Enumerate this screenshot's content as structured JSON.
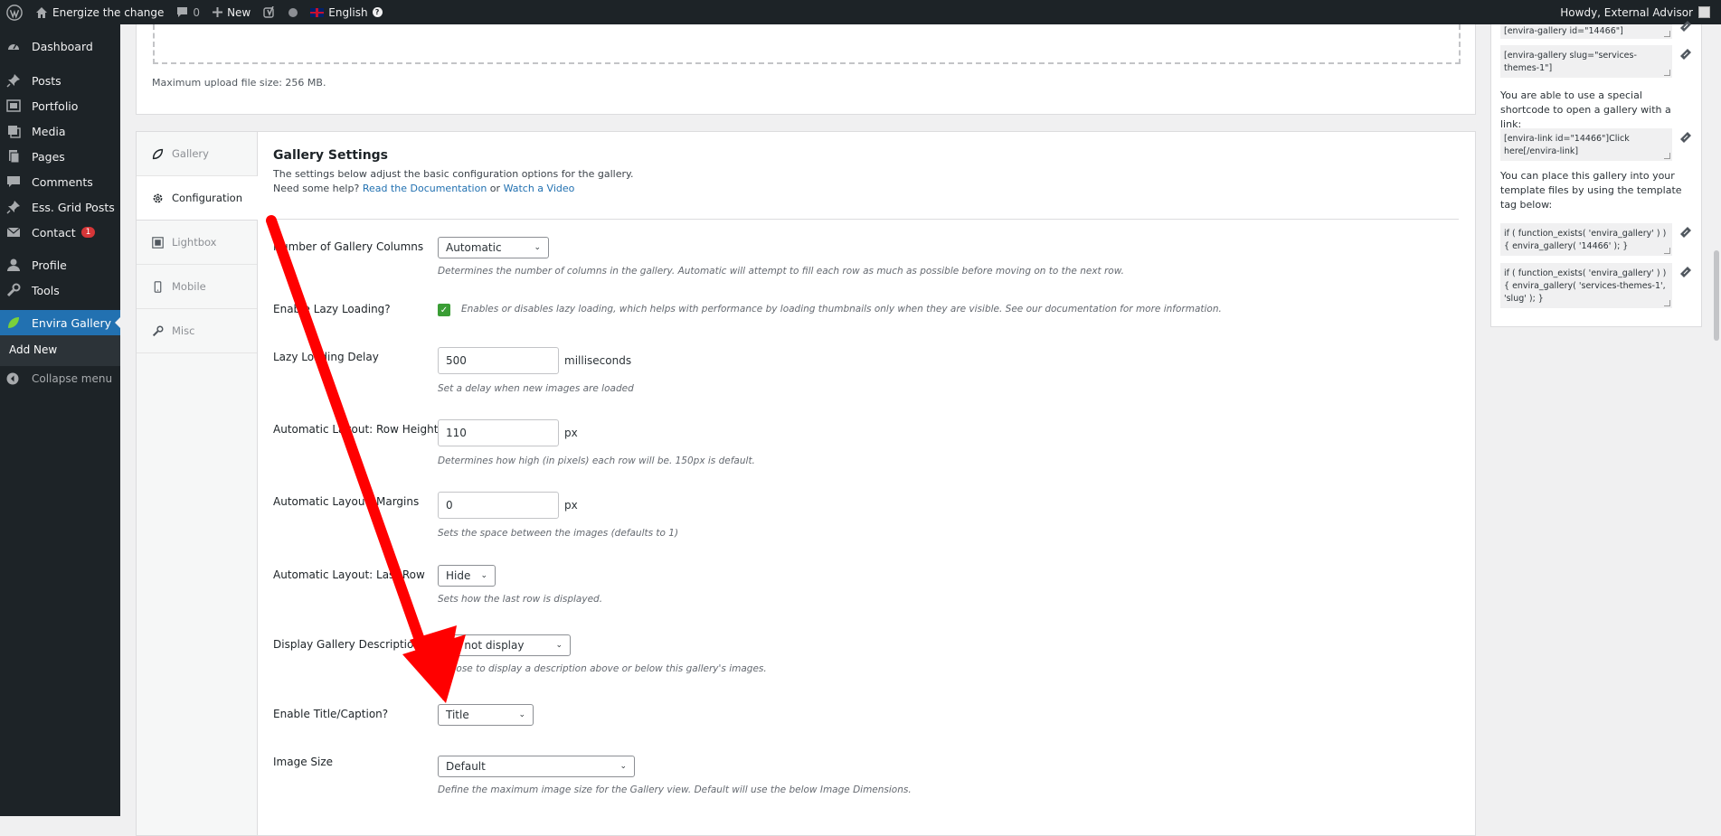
{
  "adminbar": {
    "site_name": "Energize the change",
    "comments_count": "0",
    "new_label": "New",
    "language": "English",
    "howdy": "Howdy, External Advisor"
  },
  "sidebar": {
    "items": [
      {
        "label": "Dashboard",
        "icon": "dashboard-icon"
      },
      {
        "label": "Posts",
        "icon": "pin-icon"
      },
      {
        "label": "Portfolio",
        "icon": "portfolio-icon"
      },
      {
        "label": "Media",
        "icon": "media-icon"
      },
      {
        "label": "Pages",
        "icon": "pages-icon"
      },
      {
        "label": "Comments",
        "icon": "comments-icon"
      },
      {
        "label": "Ess. Grid Posts",
        "icon": "pin-icon"
      },
      {
        "label": "Contact",
        "icon": "mail-icon",
        "badge": "1"
      },
      {
        "label": "Profile",
        "icon": "user-icon"
      },
      {
        "label": "Tools",
        "icon": "wrench-icon"
      },
      {
        "label": "Envira Gallery",
        "icon": "leaf-icon"
      }
    ],
    "submenu_add_new": "Add New",
    "collapse_label": "Collapse menu"
  },
  "upload": {
    "note": "Maximum upload file size: 256 MB."
  },
  "tabs": [
    {
      "label": "Gallery",
      "icon": "leaf-icon"
    },
    {
      "label": "Configuration",
      "icon": "gear-icon"
    },
    {
      "label": "Lightbox",
      "icon": "lightbox-icon"
    },
    {
      "label": "Mobile",
      "icon": "mobile-icon"
    },
    {
      "label": "Misc",
      "icon": "wrench-icon"
    }
  ],
  "settings": {
    "title": "Gallery Settings",
    "description": "The settings below adjust the basic configuration options for the gallery.",
    "help_prefix": "Need some help?",
    "help_link_docs": "Read the Documentation",
    "help_or": "or",
    "help_link_video": "Watch a Video",
    "columns": {
      "label": "Number of Gallery Columns",
      "value": "Automatic",
      "desc": "Determines the number of columns in the gallery. Automatic will attempt to fill each row as much as possible before moving on to the next row."
    },
    "lazy": {
      "label": "Enable Lazy Loading?",
      "checked": true,
      "desc": "Enables or disables lazy loading, which helps with performance by loading thumbnails only when they are visible. See our documentation for more information."
    },
    "lazy_delay": {
      "label": "Lazy Loading Delay",
      "value": "500",
      "unit": "milliseconds",
      "desc": "Set a delay when new images are loaded"
    },
    "row_height": {
      "label": "Automatic Layout: Row Height",
      "value": "110",
      "unit": "px",
      "desc": "Determines how high (in pixels) each row will be. 150px is default."
    },
    "margins": {
      "label": "Automatic Layout: Margins",
      "value": "0",
      "unit": "px",
      "desc": "Sets the space between the images (defaults to 1)"
    },
    "last_row": {
      "label": "Automatic Layout: Last Row",
      "value": "Hide",
      "desc": "Sets how the last row is displayed."
    },
    "description_display": {
      "label": "Display Gallery Description?",
      "value": "Do not display",
      "desc": "Choose to display a description above or below this gallery's images."
    },
    "title_caption": {
      "label": "Enable Title/Caption?",
      "value": "Title"
    },
    "image_size": {
      "label": "Image Size",
      "value": "Default",
      "desc": "Define the maximum image size for the Gallery view. Default will use the below Image Dimensions."
    }
  },
  "meta": {
    "code1": "[envira-gallery id=\"14466\"]",
    "code2": "[envira-gallery slug=\"services-themes-1\"]",
    "text_link": "You are able to use a special shortcode to open a gallery with a link:",
    "code3": "[envira-link id=\"14466\"]Click here[/envira-link]",
    "text_template": "You can place this gallery into your template files by using the template tag below:",
    "code4": "if ( function_exists( 'envira_gallery' ) ) { envira_gallery( '14466' ); }",
    "code5": "if ( function_exists( 'envira_gallery' ) ) { envira_gallery( 'services-themes-1', 'slug' ); }"
  },
  "colors": {
    "admin_dark": "#1d2327",
    "accent": "#2271b1",
    "annotation_arrow": "#ff0000",
    "checkbox_green": "#3a9d35"
  }
}
